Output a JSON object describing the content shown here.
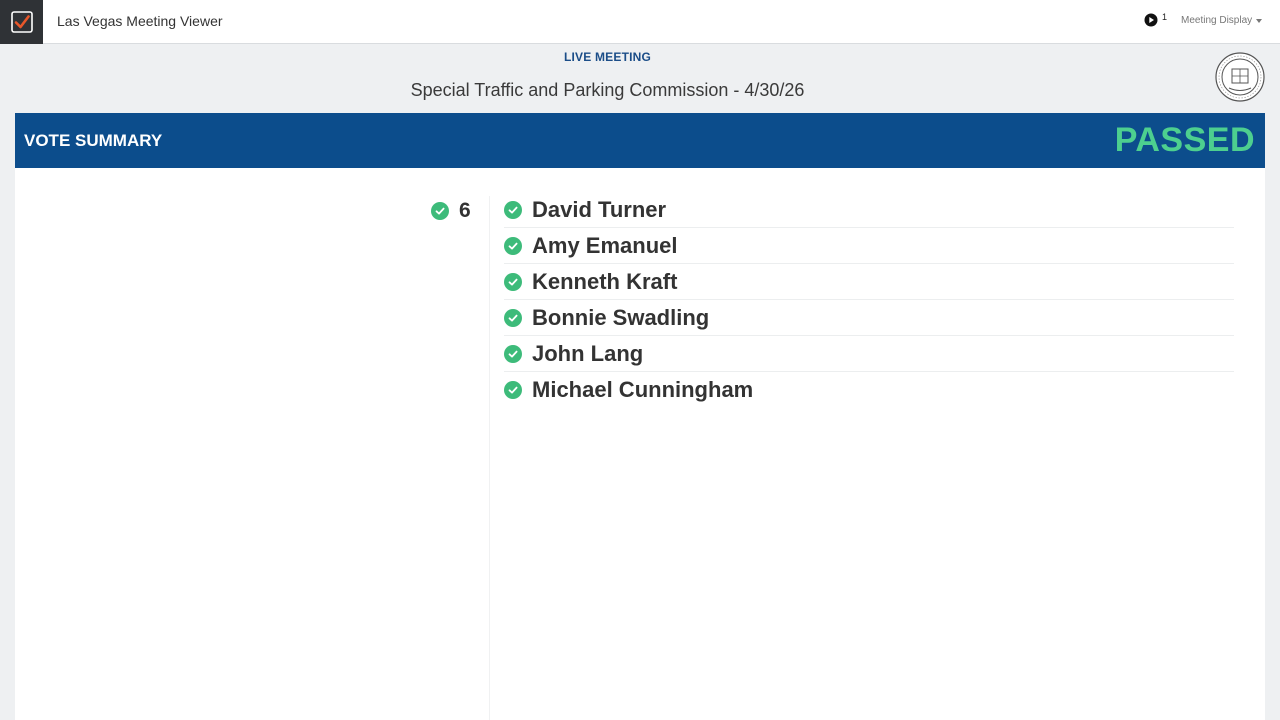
{
  "header": {
    "app_title": "Las Vegas Meeting Viewer",
    "play_count": "1",
    "display_menu_label": "Meeting Display"
  },
  "meeting": {
    "status_label": "LIVE MEETING",
    "title": "Special Traffic and Parking Commission - 4/30/26"
  },
  "vote": {
    "section_title": "VOTE SUMMARY",
    "result": "PASSED",
    "yes_count": "6",
    "voters": [
      {
        "name": "David Turner"
      },
      {
        "name": "Amy Emanuel"
      },
      {
        "name": "Kenneth Kraft"
      },
      {
        "name": "Bonnie Swadling"
      },
      {
        "name": "John Lang"
      },
      {
        "name": "Michael Cunningham"
      }
    ]
  },
  "colors": {
    "brand_blue": "#0c4d8c",
    "passed_green": "#4dcf8f",
    "check_green": "#3dbb7a",
    "logo_accent": "#e8572a"
  },
  "icons": {
    "app_logo": "checkbox-icon",
    "play": "play-icon",
    "seal": "city-seal-icon",
    "vote_yes": "check-circle-icon"
  }
}
